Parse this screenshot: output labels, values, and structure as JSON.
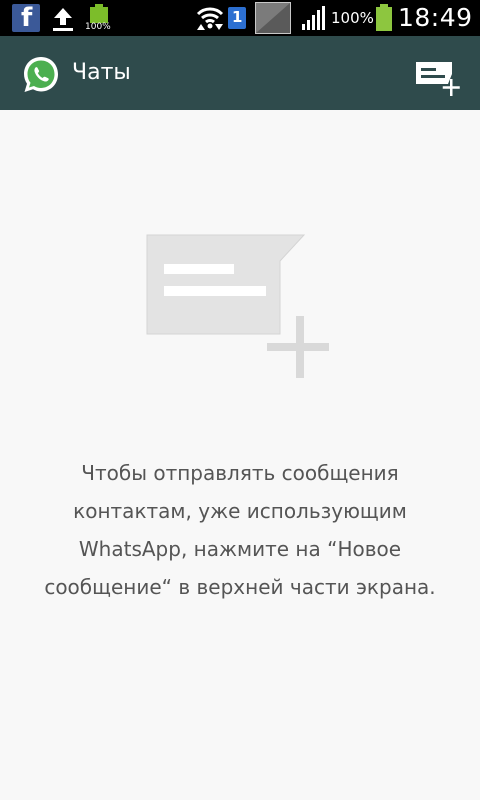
{
  "status_bar": {
    "facebook_icon": "facebook-icon",
    "facebook_letter": "f",
    "upload_icon": "upload-icon",
    "small_battery_label": "100%",
    "sim_label": "1",
    "battery_percent": "100%",
    "time": "18:49"
  },
  "action_bar": {
    "title": "Чаты",
    "logo_icon": "whatsapp-logo-icon",
    "new_chat_icon": "new-message-icon"
  },
  "empty_state": {
    "illustration_icon": "new-message-icon",
    "message": "Чтобы отправлять сообщения контактам, уже использующим WhatsApp, нажмите на “Новое сообщение“ в верхней части экрана."
  },
  "colors": {
    "action_bar": "#2f4b4c",
    "status_bar": "#000000",
    "background": "#f8f8f8",
    "text": "#555555",
    "whatsapp_green": "#4caf50"
  }
}
